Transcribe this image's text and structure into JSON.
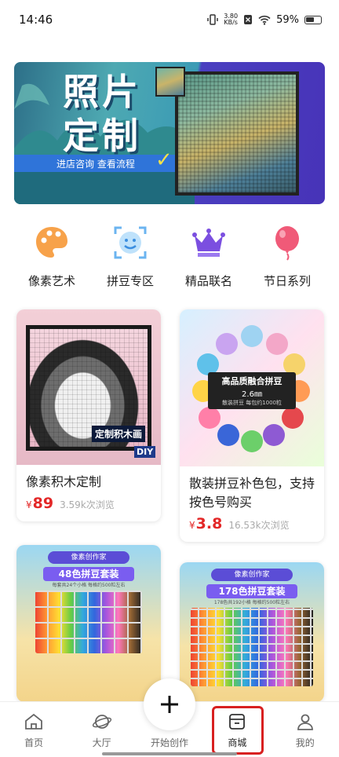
{
  "status_bar": {
    "time": "14:46",
    "net_speed_value": "3.80",
    "net_speed_unit": "KB/s",
    "battery": "59%",
    "icons": [
      "vibrate-icon",
      "no-sim-icon",
      "wifi-icon",
      "battery-icon"
    ]
  },
  "banner": {
    "title_line1": "照片",
    "title_line2": "定制",
    "subtitle": "进店咨询  查看流程"
  },
  "categories": [
    {
      "label": "像素艺术",
      "icon": "palette-icon",
      "color": "#f7a24a"
    },
    {
      "label": "拼豆专区",
      "icon": "smile-frame-icon",
      "color": "#6bb4f0"
    },
    {
      "label": "精品联名",
      "icon": "crown-icon",
      "color": "#7b4fe0"
    },
    {
      "label": "节日系列",
      "icon": "balloon-icon",
      "color": "#f05a78"
    }
  ],
  "products": [
    {
      "title": "像素积木定制",
      "price": "89",
      "currency": "¥",
      "views": "3.59k次浏览",
      "image_caption": "定制积木画",
      "image_badge": "DIY"
    },
    {
      "title": "散装拼豆补色包，支持按色号购买",
      "price": "3.8",
      "currency": "¥",
      "views": "16.53k次浏览",
      "image_caption": "高品质融合拼豆",
      "image_size": "2.6㎜",
      "image_note": "散装拼豆   每包约1000粒"
    },
    {
      "title": "",
      "image_header": "像素创作家",
      "image_caption": "48色拼豆套装",
      "image_note": "每套共24个小格   每格约500粒左右"
    },
    {
      "title": "",
      "image_header": "像素创作家",
      "image_caption": "178色拼豆套装",
      "image_note": "178色共192小格  每格约500粒左右"
    }
  ],
  "tabbar": {
    "items": [
      {
        "label": "首页",
        "icon": "home-icon"
      },
      {
        "label": "大厅",
        "icon": "planet-icon"
      },
      {
        "label": "开始创作",
        "icon": "plus-icon"
      },
      {
        "label": "商城",
        "icon": "shop-icon"
      },
      {
        "label": "我的",
        "icon": "user-icon"
      }
    ],
    "active_highlight_color": "#d82020"
  },
  "accent_colors": {
    "price": "#e32727",
    "banner_blue": "#2f74d9",
    "banner_purple": "#4733b8"
  }
}
